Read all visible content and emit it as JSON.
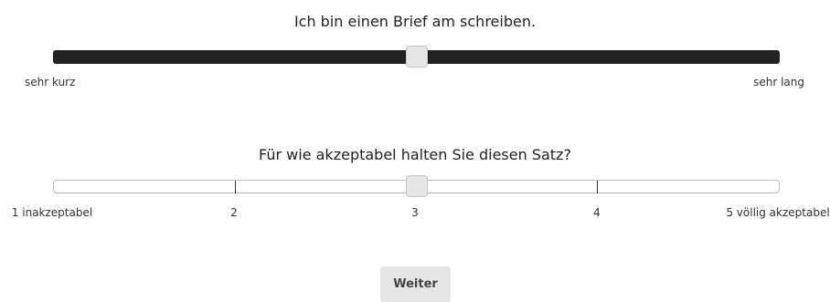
{
  "question1": {
    "text": "Ich bin einen Brief am schreiben.",
    "slider_value": 0.5,
    "left_label": "sehr kurz",
    "right_label": "sehr lang"
  },
  "question2": {
    "text": "Für wie akzeptabel halten Sie diesen Satz?",
    "slider_value": 3,
    "scale_labels": [
      "1 inakzeptabel",
      "2",
      "3",
      "4",
      "5 völlig akzeptabel"
    ]
  },
  "continue_button": {
    "label": "Weiter"
  },
  "colors": {
    "dark_track": "#222222",
    "handle": "#e6e6e6",
    "button_bg": "#e6e6e6"
  }
}
